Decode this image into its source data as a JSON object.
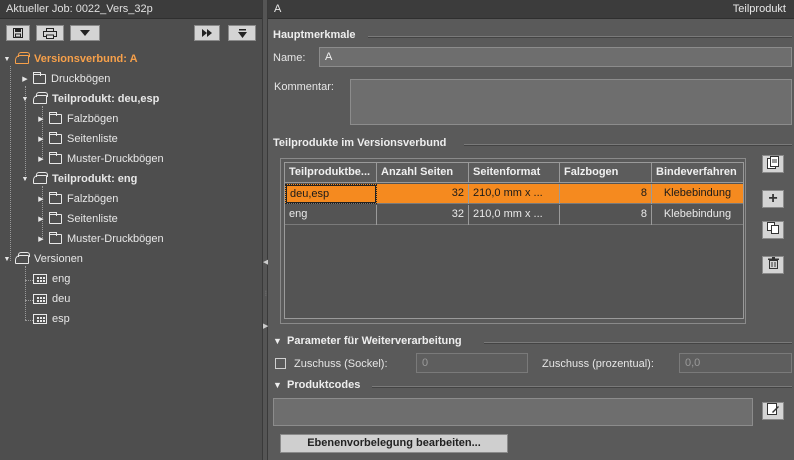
{
  "left": {
    "header": "Aktueller Job: 0022_Vers_32p",
    "toolbar": {
      "save_icon": "floppy-icon",
      "print_icon": "printer-icon",
      "dropdown_icon": "chevron-down-icon",
      "forward_icon": "fast-forward-icon",
      "expand_icon": "collapse-down-icon"
    },
    "tree": {
      "root": "Versionsverbund: A",
      "druckboegen": "Druckbögen",
      "tp1": "Teilprodukt: deu,esp",
      "tp1_falz": "Falzbögen",
      "tp1_seiten": "Seitenliste",
      "tp1_muster": "Muster-Druckbögen",
      "tp2": "Teilprodukt: eng",
      "tp2_falz": "Falzbögen",
      "tp2_seiten": "Seitenliste",
      "tp2_muster": "Muster-Druckbögen",
      "versionen": "Versionen",
      "v_eng": "eng",
      "v_deu": "deu",
      "v_esp": "esp"
    }
  },
  "right": {
    "header_left": "A",
    "header_right": "Teilprodukt",
    "haupt": {
      "title": "Hauptmerkmale",
      "name_label": "Name:",
      "name_value": "A",
      "kommentar_label": "Kommentar:",
      "kommentar_value": ""
    },
    "teilprodukte": {
      "title": "Teilprodukte im Versionsverbund",
      "columns": [
        "Teilproduktbe...",
        "Anzahl Seiten",
        "Seitenformat",
        "Falzbogen",
        "Bindeverfahren"
      ],
      "rows": [
        [
          "deu,esp",
          "32",
          "210,0 mm x ...",
          "8",
          "Klebebindung"
        ],
        [
          "eng",
          "32",
          "210,0 mm x ...",
          "8",
          "Klebebindung"
        ]
      ],
      "selected_row": 0
    },
    "parameter": {
      "title": "Parameter für Weiterverarbeitung",
      "zuschuss_sockel_label": "Zuschuss (Sockel):",
      "zuschuss_sockel_value": "0",
      "zuschuss_prozent_label": "Zuschuss (prozentual):",
      "zuschuss_prozent_value": "0,0"
    },
    "produktcodes": {
      "title": "Produktcodes",
      "value": ""
    },
    "ebenen_button": "Ebenenvorbelegung bearbeiten..."
  },
  "colors": {
    "accent": "#f58a1f",
    "tree_highlight": "#f7a04a",
    "panel": "#5a5a5a",
    "header": "#3c3c3c"
  }
}
